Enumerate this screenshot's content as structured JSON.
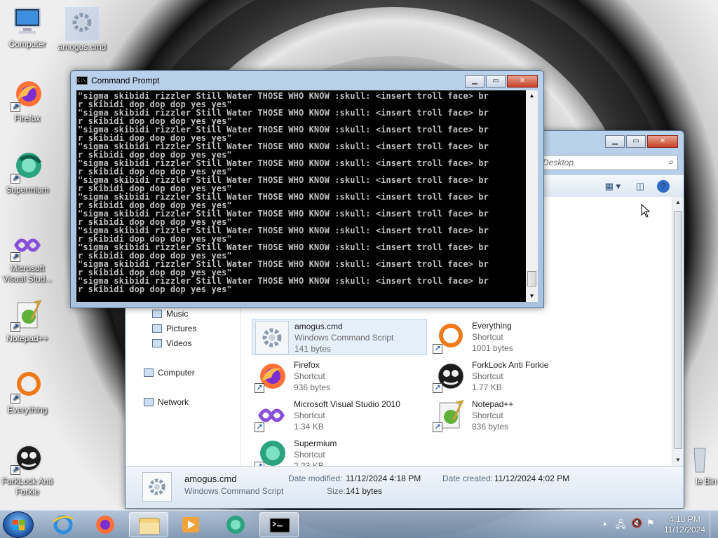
{
  "desktop": {
    "icons": [
      {
        "label": "Computer"
      },
      {
        "label": "amogus.cmd"
      },
      {
        "label": "Firefox"
      },
      {
        "label": "Supermium"
      },
      {
        "label": "Microsoft Visual Stud..."
      },
      {
        "label": "Notepad++"
      },
      {
        "label": "Everything"
      },
      {
        "label": "ForkLock Anti Forkie"
      },
      {
        "label": "le Bin"
      }
    ]
  },
  "cmd_window": {
    "title": "Command Prompt",
    "lines": [
      "\"sigma skibidi rizzler Still Water THOSE WHO KNOW :skull: <insert troll face> br",
      "r skibidi dop dop dop yes yes\"",
      "\"sigma skibidi rizzler Still Water THOSE WHO KNOW :skull: <insert troll face> br",
      "r skibidi dop dop dop yes yes\"",
      "\"sigma skibidi rizzler Still Water THOSE WHO KNOW :skull: <insert troll face> br",
      "r skibidi dop dop dop yes yes\"",
      "\"sigma skibidi rizzler Still Water THOSE WHO KNOW :skull: <insert troll face> br",
      "r skibidi dop dop dop yes yes\"",
      "\"sigma skibidi rizzler Still Water THOSE WHO KNOW :skull: <insert troll face> br",
      "r skibidi dop dop dop yes yes\"",
      "\"sigma skibidi rizzler Still Water THOSE WHO KNOW :skull: <insert troll face> br",
      "r skibidi dop dop dop yes yes\"",
      "\"sigma skibidi rizzler Still Water THOSE WHO KNOW :skull: <insert troll face> br",
      "r skibidi dop dop dop yes yes\"",
      "\"sigma skibidi rizzler Still Water THOSE WHO KNOW :skull: <insert troll face> br",
      "r skibidi dop dop dop yes yes\"",
      "\"sigma skibidi rizzler Still Water THOSE WHO KNOW :skull: <insert troll face> br",
      "r skibidi dop dop dop yes yes\"",
      "\"sigma skibidi rizzler Still Water THOSE WHO KNOW :skull: <insert troll face> br",
      "r skibidi dop dop dop yes yes\"",
      "\"sigma skibidi rizzler Still Water THOSE WHO KNOW :skull: <insert troll face> br",
      "r skibidi dop dop dop yes yes\"",
      "\"sigma skibidi rizzler Still Water THOSE WHO KNOW :skull: <insert troll face> br",
      "r skibidi dop dop dop yes yes\""
    ]
  },
  "explorer": {
    "search_placeholder": "Desktop",
    "nav": [
      "Music",
      "Pictures",
      "Videos",
      "Computer",
      "Network"
    ],
    "files": [
      {
        "name": "amogus.cmd",
        "type": "Windows Command Script",
        "size": "141 bytes"
      },
      {
        "name": "Everything",
        "type": "Shortcut",
        "size": "1001 bytes"
      },
      {
        "name": "Firefox",
        "type": "Shortcut",
        "size": "936 bytes"
      },
      {
        "name": "ForkLock Anti Forkie",
        "type": "Shortcut",
        "size": "1.77 KB"
      },
      {
        "name": "Microsoft Visual Studio 2010",
        "type": "Shortcut",
        "size": "1.34 KB"
      },
      {
        "name": "Notepad++",
        "type": "Shortcut",
        "size": "836 bytes"
      },
      {
        "name": "Supermium",
        "type": "Shortcut",
        "size": "2.23 KB"
      }
    ],
    "details": {
      "name": "amogus.cmd",
      "type": "Windows Command Script",
      "modified_label": "Date modified:",
      "modified_value": "11/12/2024 4:18 PM",
      "created_label": "Date created:",
      "created_value": "11/12/2024 4:02 PM",
      "size_label": "Size:",
      "size_value": "141 bytes"
    }
  },
  "taskbar": {
    "time": "4:18 PM",
    "date": "11/12/2024"
  }
}
